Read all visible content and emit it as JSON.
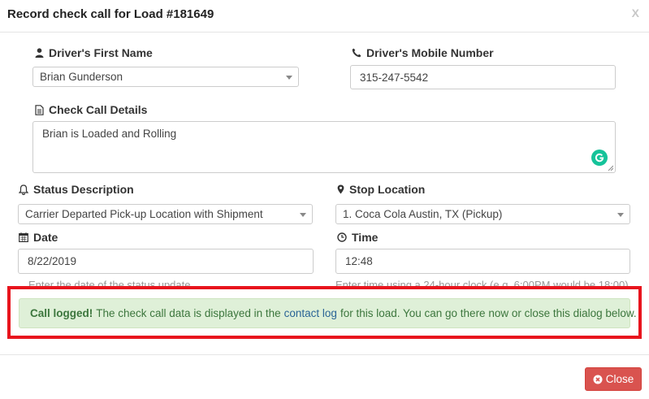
{
  "dialog": {
    "title": "Record check call for Load #181649",
    "close_x": "X"
  },
  "form": {
    "driver_first_name": {
      "label": "Driver's First Name",
      "value": "Brian Gunderson"
    },
    "driver_mobile": {
      "label": "Driver's Mobile Number",
      "value": "315-247-5542"
    },
    "check_call_details": {
      "label": "Check Call Details",
      "value": "Brian is Loaded and Rolling"
    },
    "status_description": {
      "label": "Status Description",
      "value": "Carrier Departed Pick-up Location with Shipment"
    },
    "stop_location": {
      "label": "Stop Location",
      "value": "1. Coca Cola Austin, TX (Pickup)"
    },
    "date": {
      "label": "Date",
      "value": "8/22/2019",
      "help": "Enter the date of the status update"
    },
    "time": {
      "label": "Time",
      "value": "12:48",
      "help": "Enter time using a 24-hour clock (e.g. 6:00PM would be 18:00)"
    }
  },
  "alert": {
    "strong": "Call logged!",
    "text_before": "The check call data is displayed in the",
    "link": "contact log",
    "text_after": "for this load. You can go there now or close this dialog below."
  },
  "footer": {
    "close_label": "Close"
  },
  "colors": {
    "alert_bg": "#dff0d8",
    "alert_text": "#3c763d",
    "highlight": "#e8141d",
    "danger": "#d9534f",
    "link": "#2a6496"
  }
}
